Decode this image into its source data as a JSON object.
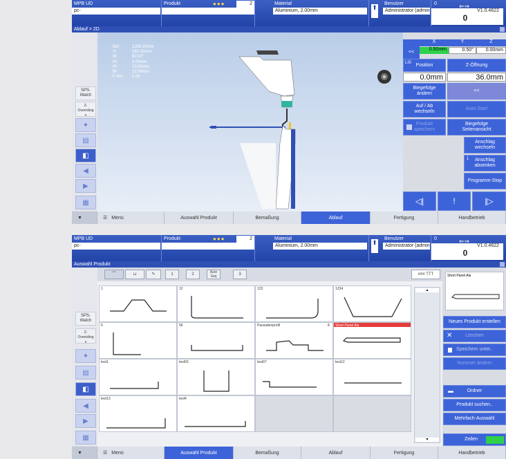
{
  "header": {
    "machine": "MPB UD",
    "machine_sub": "pc-",
    "product_label": "Produkt",
    "product_value": "",
    "product_num": "2",
    "material_label": "Material",
    "material_value": "Aluminium, 2.00mm",
    "user_label": "Benutzer",
    "user_value": "Administrator (admin)",
    "user_num": "0",
    "version": "V1.0.4622",
    "counter": "0"
  },
  "screen1": {
    "title": "Ablauf > 2D",
    "sidebar": {
      "sps": "SPS-\nWatch",
      "override": "Z-\nOverriding\nx"
    },
    "params": [
      {
        "k": "Bbr:",
        "v": "1306.00mm"
      },
      {
        "k": "V:",
        "v": "260.00mm"
      },
      {
        "k": "W:",
        "v": "90.00°"
      },
      {
        "k": "Pr:",
        "v": "0.00mm"
      },
      {
        "k": "Pr:",
        "v": "10.00mm"
      },
      {
        "k": "Bl:",
        "v": "21.00mm"
      },
      {
        "k": "F-km:",
        "v": "0.00"
      }
    ],
    "right": {
      "prev": "<<",
      "x": "X",
      "y": "Y",
      "z": "Z",
      "x_val": "0.50mm",
      "y_val": "0.50°",
      "z_val": "0.00mm",
      "lis": "LIS",
      "position": "Position",
      "z_oeffnung": "Z-Öffnung",
      "pos_val": "0.0mm",
      "z_val2": "36.0mm",
      "biegefolge_aendern": "Biegefolge\nändern",
      "back": "<<",
      "auf_ab": "Auf / Ab\nwechseln",
      "autostart": "Auto-Start",
      "produkt_speichern": "Produkt\nspeichern",
      "biegefolge_seiten": "Biegefolge\nSeitenansicht",
      "anschlag_wechseln": "Anschlag\nwechseln",
      "anschlag_absenken": "Anschlag\nabsenken",
      "anschlag_num": "1",
      "programm_stop": "Programm-Stop"
    },
    "tabs": [
      "Menü",
      "Auswahl Produkt",
      "Bemaßung",
      "Ablauf",
      "Fertigung",
      "Handbetrieb"
    ]
  },
  "screen2": {
    "title": "Auswahl Produkt",
    "toolbar": {
      "b1": "1",
      "b2": "2",
      "auto": "Auto\nSeq",
      "b3": "3",
      "ttt": "### TTT"
    },
    "products": [
      "1",
      "12",
      "123",
      "1234",
      "6",
      "56",
      "Passadenprofil",
      "Short Panel Alu",
      "test1",
      "test03",
      "test07",
      "test12",
      "test13",
      "test4"
    ],
    "passade_num": "8",
    "preview_label": "Short Panel Alu",
    "actions": [
      "Neues Produkt erstellen",
      "Löschen",
      "Speichern unter..",
      "Nummer ändern",
      "Ordner",
      "Produkt suchen..",
      "Mehrfach-Auswahl",
      "Zeilen"
    ],
    "tabs": [
      "Menü",
      "Auswahl Produkt",
      "Bemaßung",
      "Ablauf",
      "Fertigung",
      "Handbetrieb"
    ]
  }
}
